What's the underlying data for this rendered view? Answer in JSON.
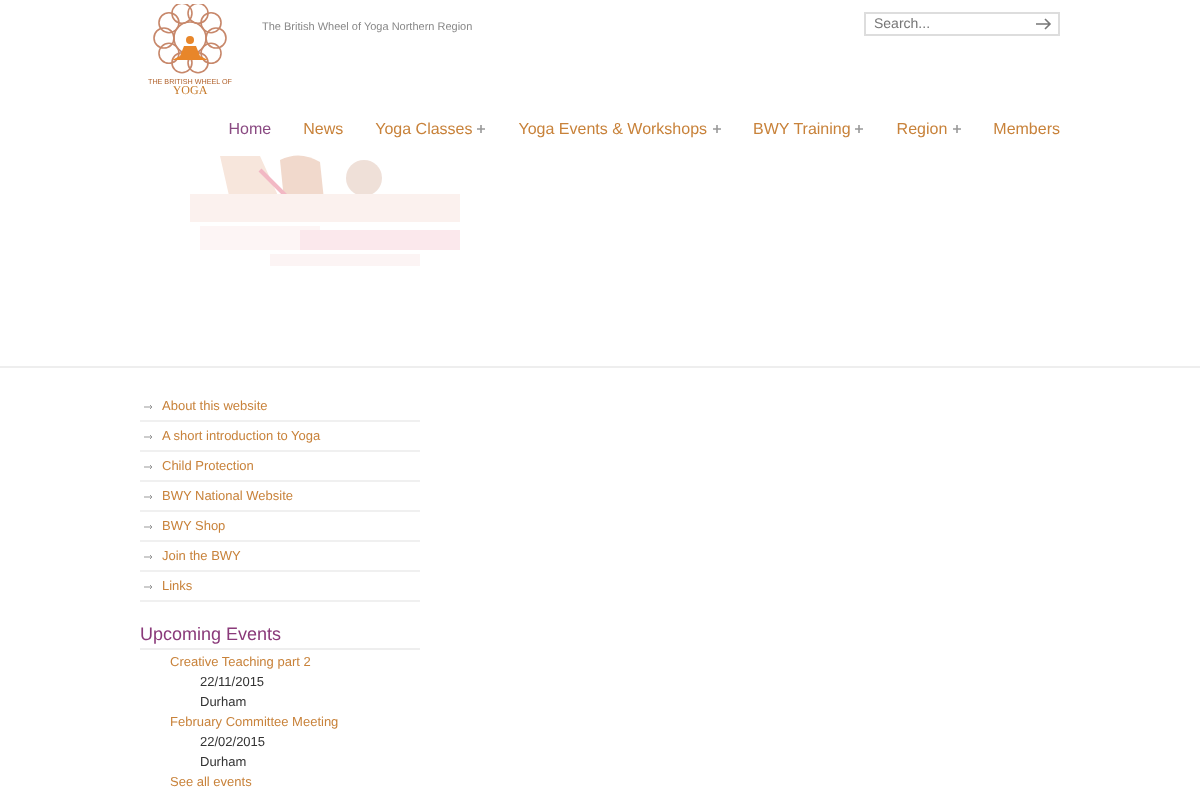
{
  "header": {
    "logo": {
      "line1": "THE BRITISH WHEEL OF",
      "line2": "YOGA"
    },
    "tagline": "The British Wheel of Yoga Northern Region",
    "search": {
      "placeholder": "Search..."
    }
  },
  "nav": [
    {
      "label": "Home",
      "selected": true,
      "has_submenu": false
    },
    {
      "label": "News",
      "selected": false,
      "has_submenu": false
    },
    {
      "label": "Yoga Classes",
      "selected": false,
      "has_submenu": true
    },
    {
      "label": "Yoga Events & Workshops",
      "selected": false,
      "has_submenu": true
    },
    {
      "label": "BWY Training",
      "selected": false,
      "has_submenu": true
    },
    {
      "label": "Region",
      "selected": false,
      "has_submenu": true
    },
    {
      "label": "Members",
      "selected": false,
      "has_submenu": false
    }
  ],
  "sidebar_links": [
    "About this website",
    "A short introduction to Yoga",
    "Child Protection",
    "BWY National Website",
    "BWY Shop",
    "Join the BWY",
    "Links"
  ],
  "upcoming_events": {
    "title": "Upcoming Events",
    "events": [
      {
        "name": "Creative Teaching part 2",
        "date": "22/11/2015",
        "place": "Durham"
      },
      {
        "name": "February Committee Meeting",
        "date": "22/02/2015",
        "place": "Durham"
      }
    ],
    "see_all": "See all events"
  }
}
